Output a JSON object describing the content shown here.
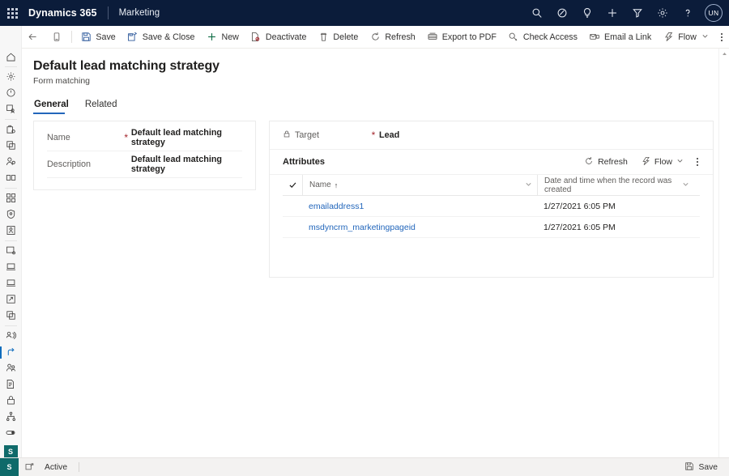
{
  "topnav": {
    "waffle_label": "app-launcher",
    "brand": "Dynamics 365",
    "app_name": "Marketing",
    "icons": [
      {
        "name": "search-icon",
        "label": "Search"
      },
      {
        "name": "focus-icon",
        "label": "Focused view"
      },
      {
        "name": "lightbulb-icon",
        "label": "Insights"
      },
      {
        "name": "plus-icon",
        "label": "New"
      },
      {
        "name": "filter-icon",
        "label": "Filter"
      },
      {
        "name": "gear-icon",
        "label": "Settings"
      },
      {
        "name": "help-icon",
        "label": "Help"
      }
    ],
    "avatar_initials": "UN"
  },
  "commandbar": {
    "buttons": [
      {
        "name": "back-button",
        "label": "",
        "icon": "arrow-left-icon"
      },
      {
        "name": "form-selector-button",
        "label": "",
        "icon": "form-icon"
      },
      {
        "name": "save-button",
        "label": "Save",
        "icon": "save-icon"
      },
      {
        "name": "save-and-close-button",
        "label": "Save & Close",
        "icon": "save-close-icon"
      },
      {
        "name": "new-button",
        "label": "New",
        "icon": "plus-icon"
      },
      {
        "name": "deactivate-button",
        "label": "Deactivate",
        "icon": "deactivate-icon"
      },
      {
        "name": "delete-button",
        "label": "Delete",
        "icon": "trash-icon"
      },
      {
        "name": "refresh-button",
        "label": "Refresh",
        "icon": "refresh-icon"
      },
      {
        "name": "export-to-pdf-button",
        "label": "Export to PDF",
        "icon": "pdf-icon"
      },
      {
        "name": "check-access-button",
        "label": "Check Access",
        "icon": "key-icon"
      },
      {
        "name": "email-a-link-button",
        "label": "Email a Link",
        "icon": "email-link-icon"
      },
      {
        "name": "flow-button",
        "label": "Flow",
        "icon": "flow-icon"
      }
    ],
    "overflow_label": "More commands"
  },
  "sidebar": {
    "hamburger_label": "Site map",
    "items": [
      {
        "name": "sidebar-item-home",
        "icon": "home-icon"
      },
      {
        "name": "sidebar-item-settings",
        "icon": "gear-icon"
      },
      {
        "name": "sidebar-item-recent",
        "icon": "clock-icon"
      },
      {
        "name": "sidebar-item-pinned",
        "icon": "pin-person-icon"
      },
      {
        "name": "sidebar-item-accounts",
        "icon": "briefcase-icon"
      },
      {
        "name": "sidebar-item-copy",
        "icon": "copy-icon"
      },
      {
        "name": "sidebar-item-contacts",
        "icon": "person-icon"
      },
      {
        "name": "sidebar-item-cards",
        "icon": "card-icon"
      },
      {
        "name": "sidebar-item-segments",
        "icon": "segments-icon"
      },
      {
        "name": "sidebar-item-security",
        "icon": "shield-icon"
      },
      {
        "name": "sidebar-item-portal",
        "icon": "portal-icon"
      },
      {
        "name": "sidebar-item-window",
        "icon": "window-icon"
      },
      {
        "name": "sidebar-item-device-1",
        "icon": "monitor-icon"
      },
      {
        "name": "sidebar-item-device-2",
        "icon": "monitor-icon"
      },
      {
        "name": "sidebar-item-edit-box",
        "icon": "edit-box-icon"
      },
      {
        "name": "sidebar-item-stack",
        "icon": "stack-icon"
      },
      {
        "name": "sidebar-item-customer-voice",
        "icon": "customer-voice-icon"
      },
      {
        "name": "sidebar-item-journey",
        "icon": "journey-icon",
        "selected": true
      },
      {
        "name": "sidebar-item-people",
        "icon": "people-icon"
      },
      {
        "name": "sidebar-item-form",
        "icon": "form-page-icon"
      },
      {
        "name": "sidebar-item-lock",
        "icon": "lock-gear-icon"
      },
      {
        "name": "sidebar-item-hierarchy",
        "icon": "hierarchy-icon"
      },
      {
        "name": "sidebar-item-toggle",
        "icon": "toggle-icon"
      }
    ],
    "badge": "S"
  },
  "page": {
    "title": "Default lead matching strategy",
    "subtitle": "Form matching",
    "tabs": [
      {
        "name": "tab-general",
        "label": "General",
        "active": true
      },
      {
        "name": "tab-related",
        "label": "Related",
        "active": false
      }
    ]
  },
  "left_card": {
    "fields": [
      {
        "label": "Name",
        "required": "*",
        "value": "Default lead matching strategy"
      },
      {
        "label": "Description",
        "required": "",
        "value": "Default lead matching strategy"
      }
    ]
  },
  "right_card": {
    "target": {
      "label": "Target",
      "required": "*",
      "value": "Lead",
      "icon": "lock-icon"
    },
    "attributes": {
      "title": "Attributes",
      "refresh_label": "Refresh",
      "flow_label": "Flow",
      "overflow_label": "More commands"
    },
    "grid": {
      "select_all_label": "select-all",
      "columns": [
        {
          "label": "Name",
          "sort": "↑"
        },
        {
          "label": "Date and time when the record was created",
          "sort": ""
        }
      ],
      "rows": [
        {
          "name": "emailaddress1",
          "created": "1/27/2021 6:05 PM"
        },
        {
          "name": "msdyncrm_marketingpageid",
          "created": "1/27/2021 6:05 PM"
        }
      ]
    }
  },
  "statusbar": {
    "badge": "S",
    "chart_icon_label": "open-dashboard",
    "status": "Active",
    "save_label": "Save"
  },
  "colors": {
    "topnav_bg": "#0b1c3a",
    "accent": "#2266bb",
    "link": "#2266bb",
    "required": "#a4262c",
    "badge_teal": "#0f6a6a",
    "new_green": "#0b6a42",
    "save_blue": "#2b579a"
  }
}
